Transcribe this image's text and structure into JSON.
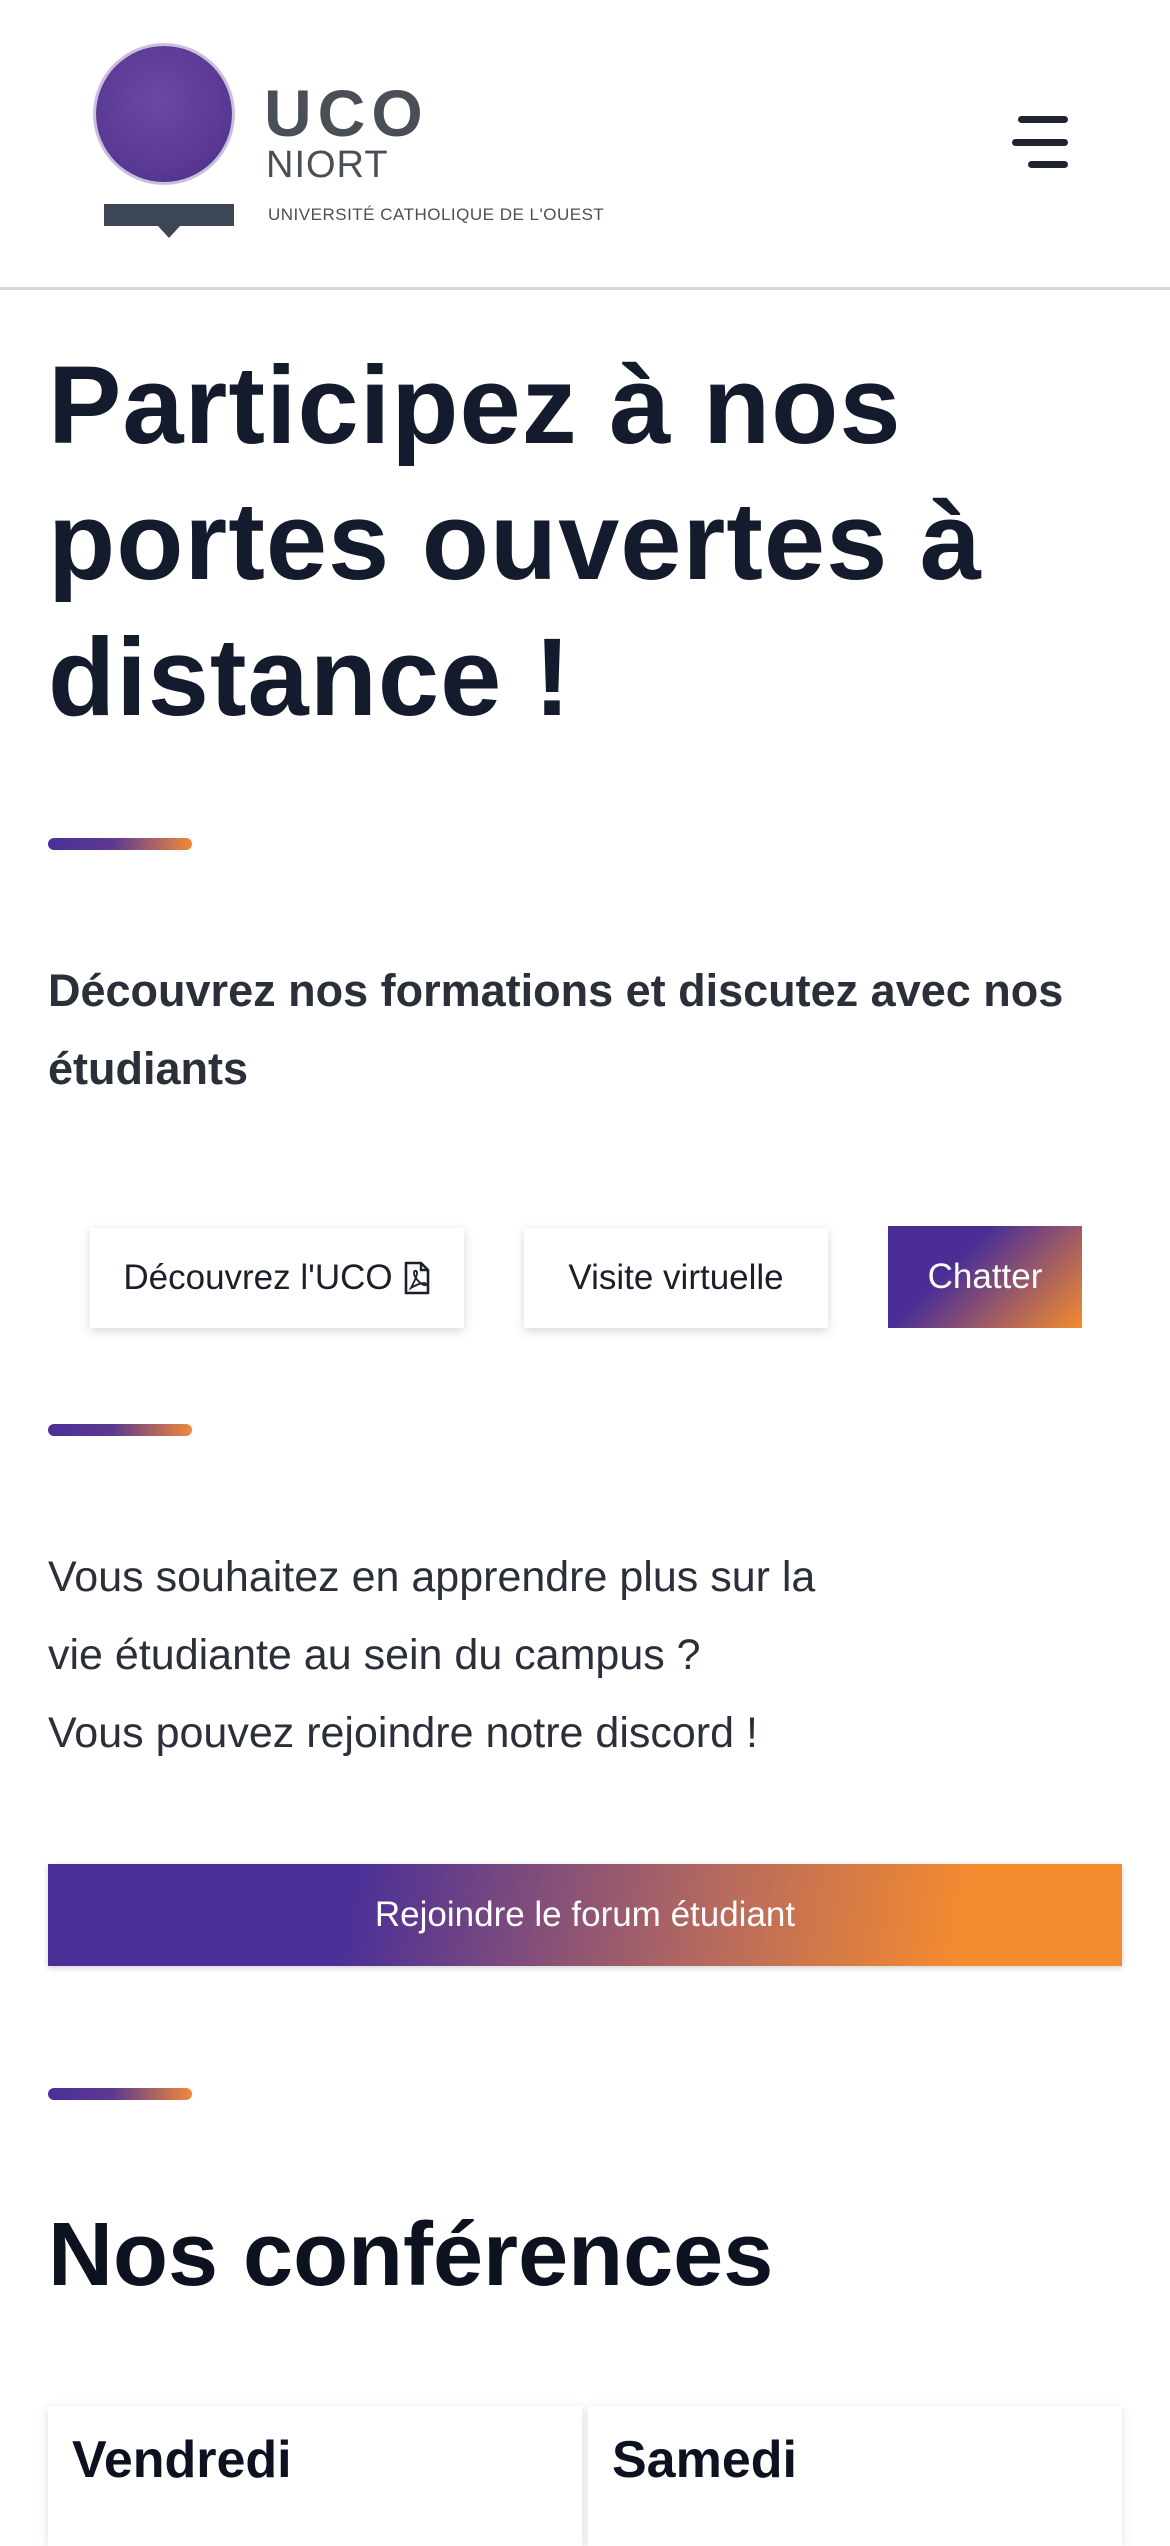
{
  "header": {
    "logo": {
      "name": "UCO",
      "city": "NIORT",
      "subtitle": "UNIVERSITÉ CATHOLIQUE DE L'OUEST"
    },
    "menu_icon": "hamburger-menu-icon"
  },
  "hero": {
    "title": "Participez à nos portes ouvertes à distance !",
    "subtitle": "Découvrez nos formations et discutez avec nos étudiants"
  },
  "actions": {
    "discover_label": "Découvrez l'UCO",
    "discover_icon": "pdf-file-icon",
    "visit_label": "Visite virtuelle",
    "chat_label": "Chatter"
  },
  "discord": {
    "line1": "Vous souhaitez en apprendre plus sur la",
    "line2": "vie étudiante au sein du campus ?",
    "line3": "Vous pouvez rejoindre notre discord !",
    "forum_label": "Rejoindre le forum étudiant"
  },
  "conferences": {
    "title": "Nos conférences",
    "days": [
      {
        "label": "Vendredi"
      },
      {
        "label": "Samedi"
      }
    ]
  },
  "colors": {
    "purple": "#4a2f98",
    "orange": "#f58b2f",
    "text_dark": "#141b2d"
  }
}
